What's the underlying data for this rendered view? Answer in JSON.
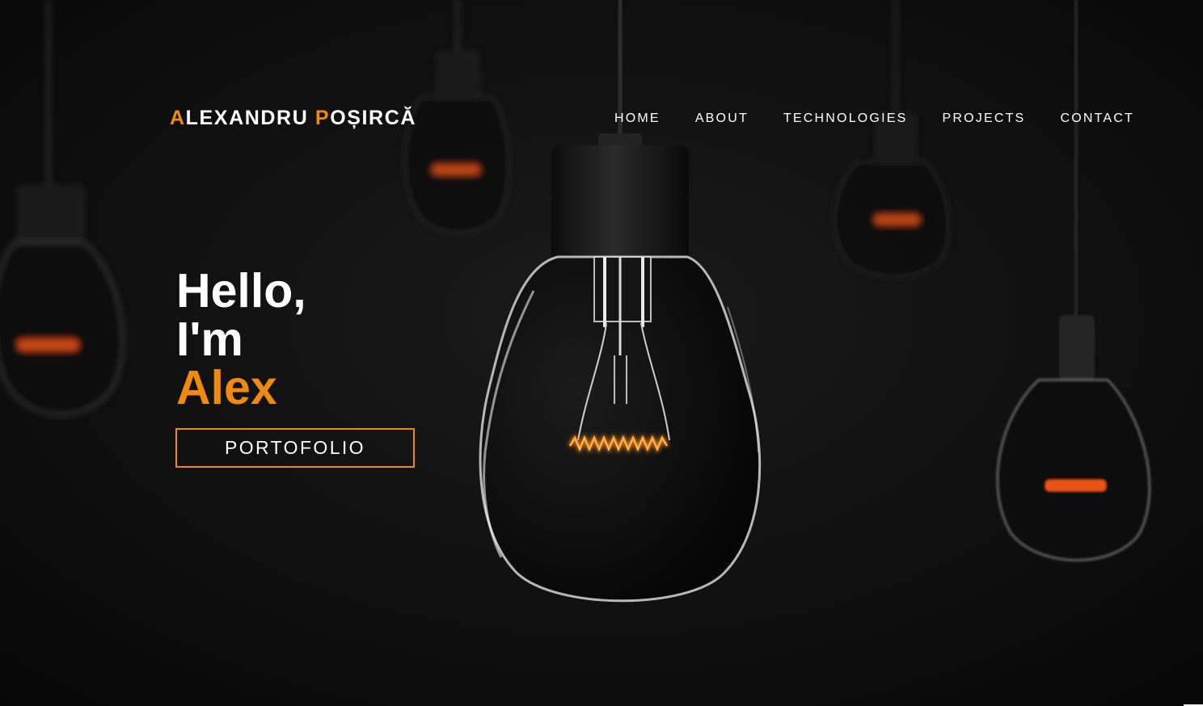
{
  "theme": {
    "accent": "#ee8a0f",
    "background": "#0a0a0a",
    "text": "#ffffff"
  },
  "brand": {
    "first_initial": "A",
    "first_rest": "LEXANDRU ",
    "last_initial": "P",
    "last_rest": "OȘIRCĂ"
  },
  "nav": {
    "home": "HOME",
    "about": "ABOUT",
    "technologies": "TECHNOLOGIES",
    "projects": "PROJECTS",
    "contact": "CONTACT"
  },
  "hero": {
    "greeting": "Hello,",
    "intro": "I'm",
    "name": "Alex",
    "cta_label": "PORTOFOLIO",
    "background_image": "dark-hanging-light-bulbs"
  }
}
